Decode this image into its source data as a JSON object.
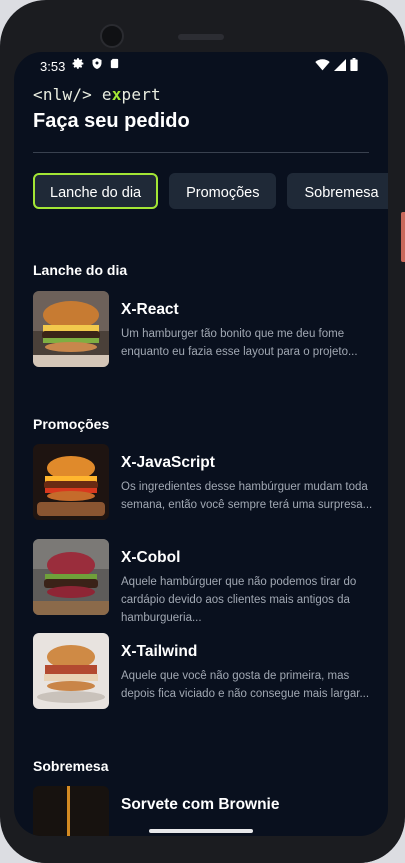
{
  "status": {
    "time": "3:53",
    "left_icons": [
      "settings-gear",
      "shield",
      "sd-card"
    ],
    "right_icons": [
      "wifi",
      "cellular",
      "battery"
    ]
  },
  "brand": {
    "logo_prefix": "<nlw/>",
    "logo_e": "e",
    "logo_x": "x",
    "logo_rest": "pert",
    "accent": "#a3e635",
    "background": "#09101e"
  },
  "header": {
    "title": "Faça seu pedido"
  },
  "tabs": [
    {
      "label": "Lanche do dia",
      "active": true
    },
    {
      "label": "Promoções",
      "active": false
    },
    {
      "label": "Sobremesa",
      "active": false
    }
  ],
  "sections": [
    {
      "title": "Lanche do dia",
      "items": [
        {
          "name": "X-React",
          "description": "Um hamburger tão bonito que me deu fome enquanto eu fazia esse layout para o projeto..."
        }
      ]
    },
    {
      "title": "Promoções",
      "items": [
        {
          "name": "X-JavaScript",
          "description": "Os ingredientes desse hambúrguer mudam toda semana, então você sempre terá uma surpresa..."
        },
        {
          "name": "X-Cobol",
          "description": "Aquele hambúrguer que não podemos tirar do cardápio devido aos clientes mais antigos da hamburgueria..."
        },
        {
          "name": "X-Tailwind",
          "description": "Aquele que você não gosta de primeira, mas depois fica viciado e não consegue mais largar..."
        }
      ]
    },
    {
      "title": "Sobremesa",
      "items": [
        {
          "name": "Sorvete com Brownie",
          "description": ""
        }
      ]
    }
  ]
}
